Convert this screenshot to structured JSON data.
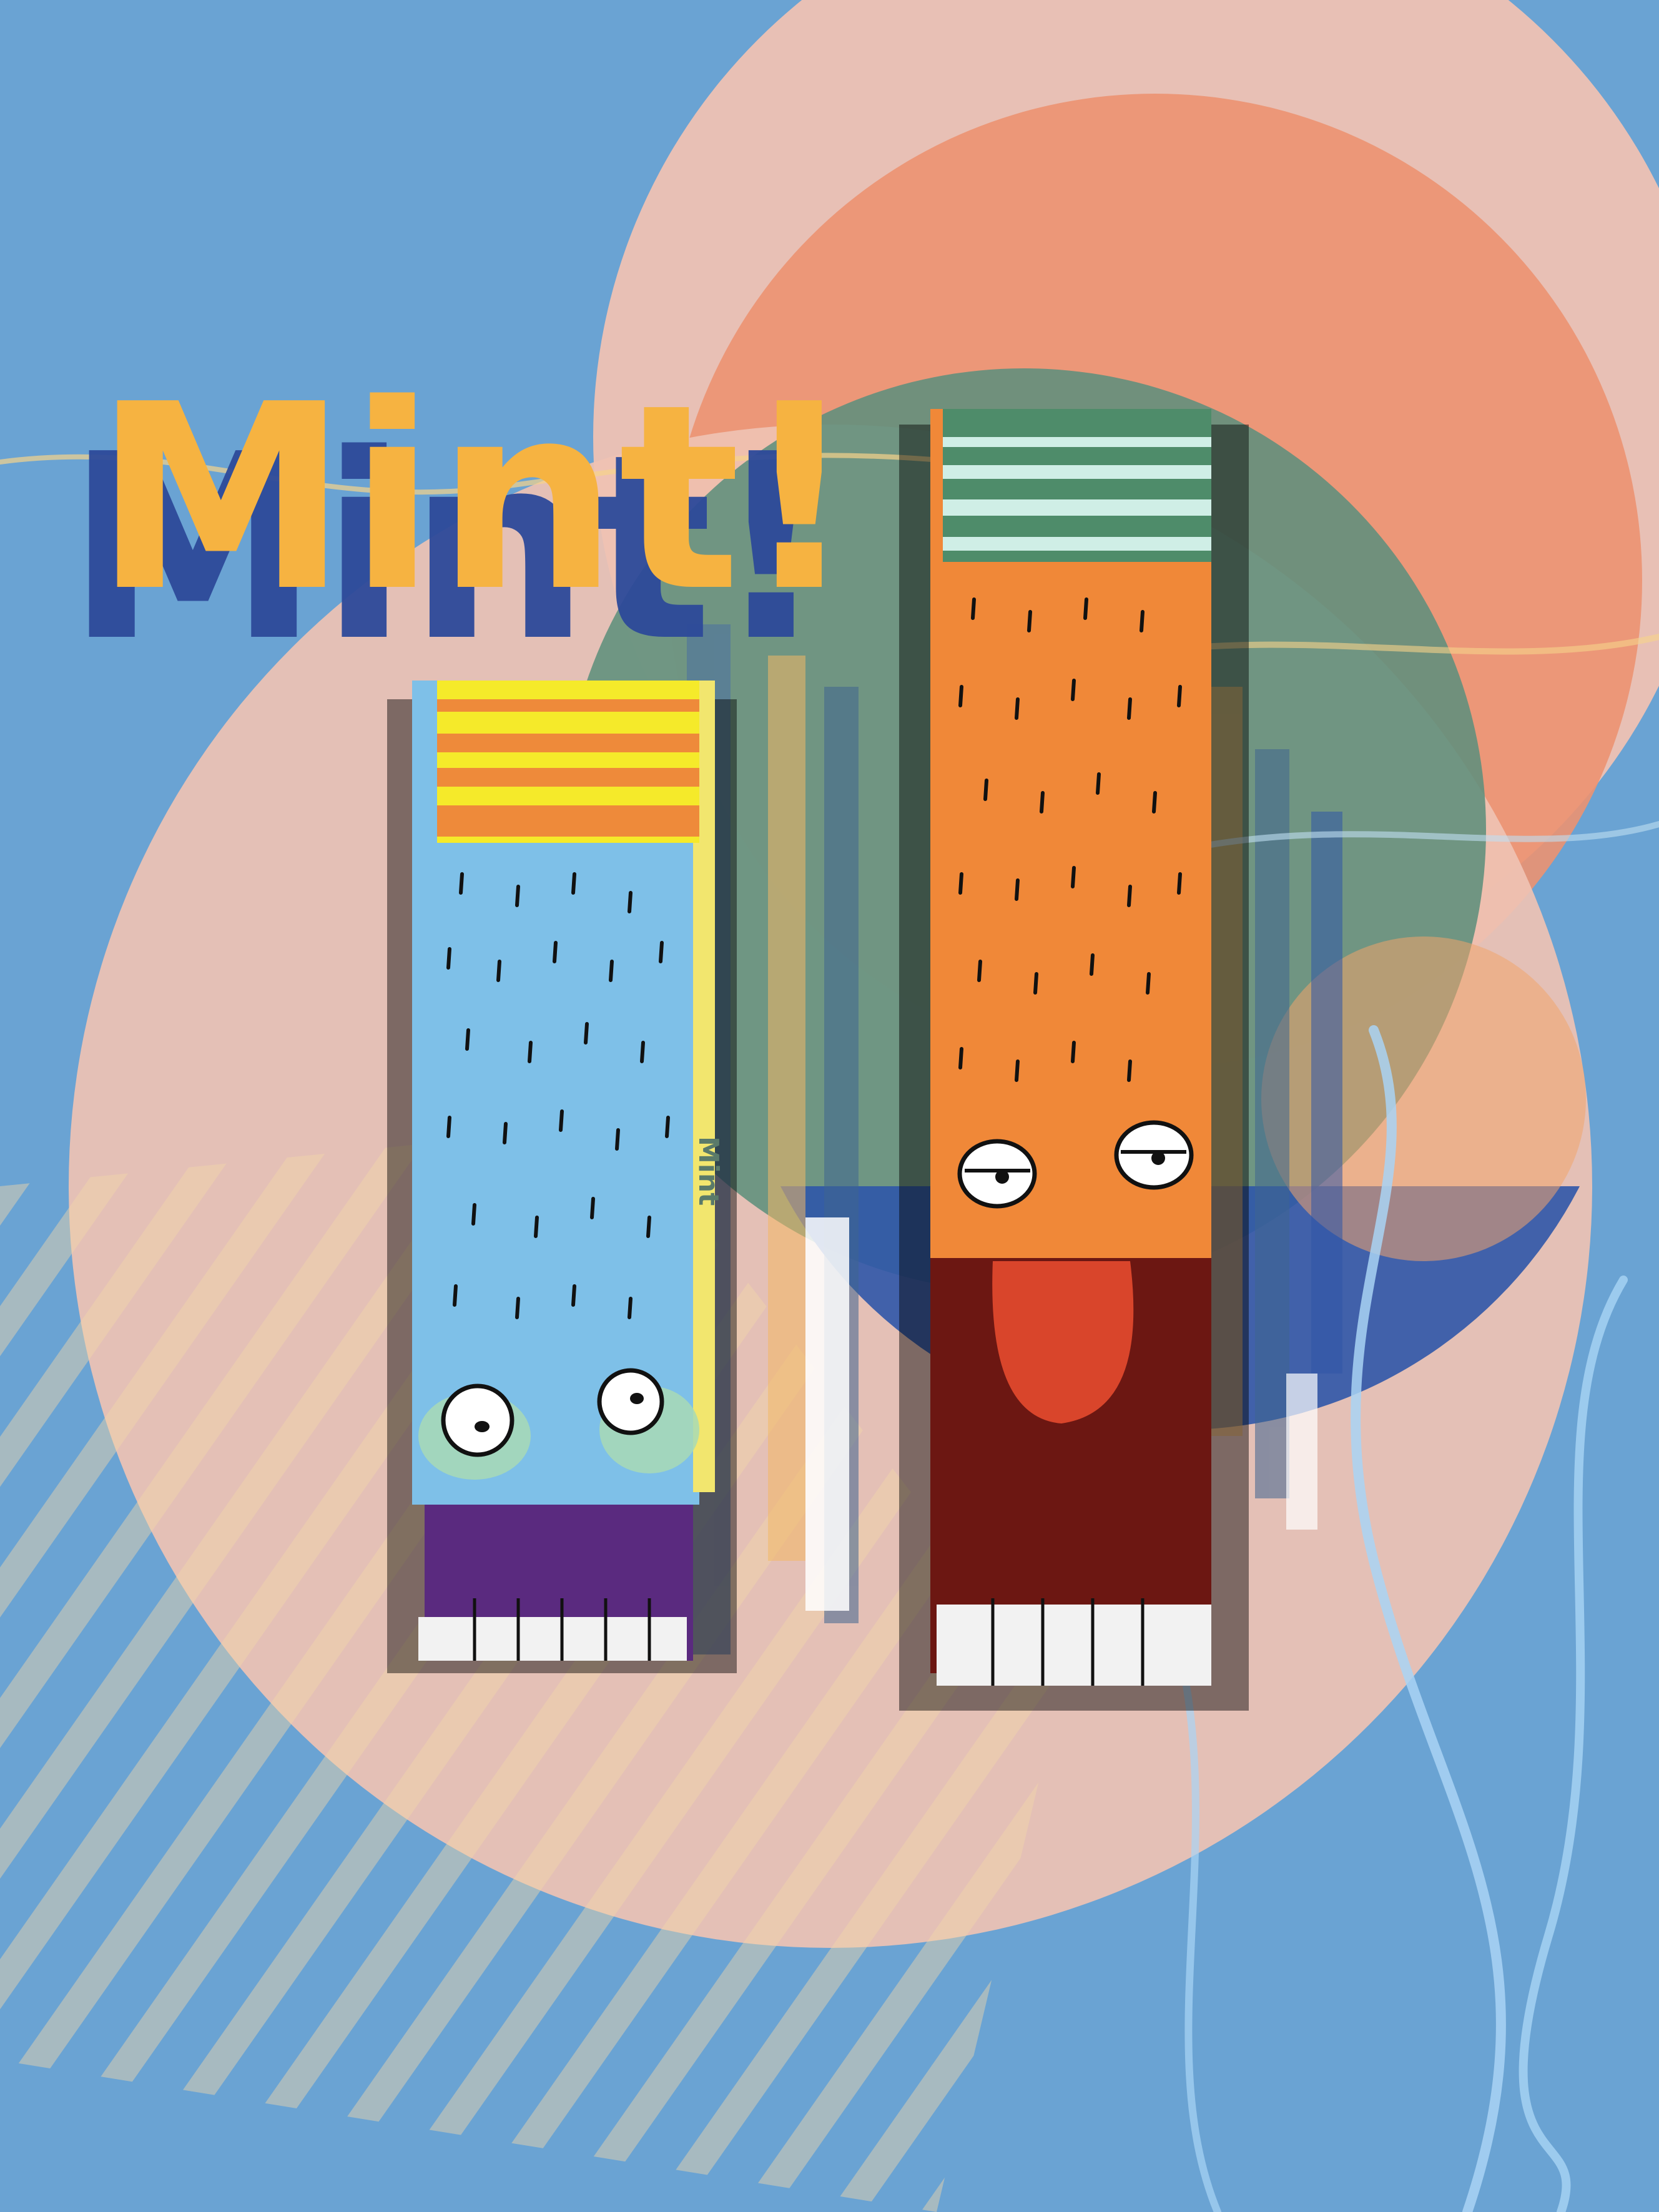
{
  "poster": {
    "title": "Mint!",
    "box_side_text": "Mint"
  },
  "colors": {
    "background": "#6aa3d3",
    "pink_circle": "#efc2b3",
    "salmon_circle": "#ec9271",
    "green_circle": "#5f8f7c",
    "navy_circle": "#2f56a8",
    "title_fill": "#f6b341",
    "title_shadow": "#2d4a9a",
    "blue_box": "#7ec0e8",
    "orange_box": "#f08838",
    "mouth_dark_red": "#6c1712",
    "tongue": "#d9452b",
    "purple_mouth": "#5a2a7f"
  },
  "characters": [
    {
      "name": "blue-box-character",
      "mood": "glancing",
      "icon": "blue-mint-box-icon"
    },
    {
      "name": "orange-box-character",
      "mood": "tongue-out",
      "icon": "orange-mint-box-icon"
    }
  ]
}
